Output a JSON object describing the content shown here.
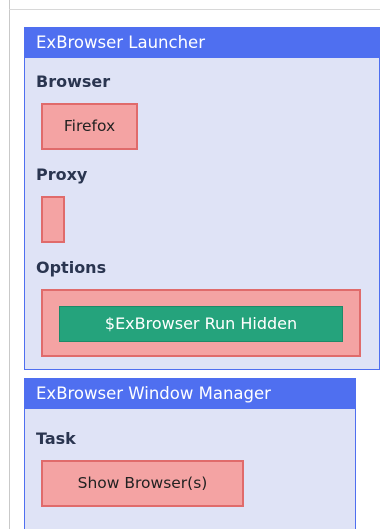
{
  "launcher": {
    "title": "ExBrowser Launcher",
    "browser": {
      "label": "Browser",
      "value": "Firefox"
    },
    "proxy": {
      "label": "Proxy",
      "value": ""
    },
    "options": {
      "label": "Options",
      "run_hidden_label": "$ExBrowser Run Hidden"
    }
  },
  "window_manager": {
    "title": "ExBrowser Window Manager",
    "task": {
      "label": "Task",
      "value": "Show Browser(s)"
    }
  },
  "colors": {
    "panel_header": "#4f6ff0",
    "panel_background": "#dfe3f6",
    "field_fill": "#f4a3a3",
    "field_border": "#e06b6b",
    "toggle_on": "#25a37c"
  }
}
